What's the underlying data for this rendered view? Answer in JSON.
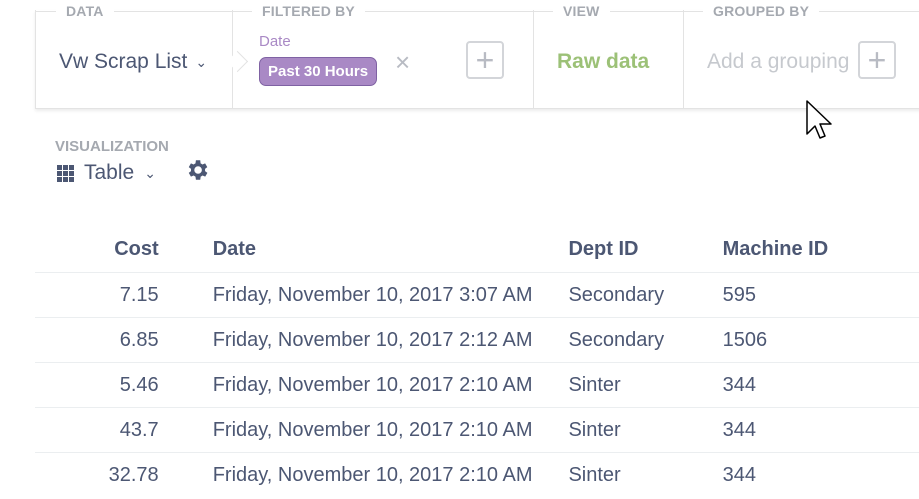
{
  "query_builder": {
    "data": {
      "label": "DATA",
      "value": "Vw Scrap List"
    },
    "filter": {
      "label": "FILTERED BY",
      "field": "Date",
      "pill": "Past 30 Hours"
    },
    "view": {
      "label": "VIEW",
      "value": "Raw data"
    },
    "group": {
      "label": "GROUPED BY",
      "placeholder": "Add a grouping"
    }
  },
  "visualization": {
    "label": "VISUALIZATION",
    "type": "Table"
  },
  "table": {
    "columns": [
      "Cost",
      "Date",
      "Dept ID",
      "Machine ID"
    ],
    "rows": [
      [
        "7.15",
        "Friday, November 10, 2017 3:07 AM",
        "Secondary",
        "595"
      ],
      [
        "6.85",
        "Friday, November 10, 2017 2:12 AM",
        "Secondary",
        "1506"
      ],
      [
        "5.46",
        "Friday, November 10, 2017 2:10 AM",
        "Sinter",
        "344"
      ],
      [
        "43.7",
        "Friday, November 10, 2017 2:10 AM",
        "Sinter",
        "344"
      ],
      [
        "32.78",
        "Friday, November 10, 2017 2:10 AM",
        "Sinter",
        "344"
      ]
    ]
  },
  "colors": {
    "filter_accent": "#a989c5",
    "view_accent": "#9cc177",
    "text": "#4c5773"
  },
  "icons": [
    "chevron-down-icon",
    "close-icon",
    "plus-icon",
    "grid-icon",
    "gear-icon",
    "mouse-cursor-icon"
  ]
}
